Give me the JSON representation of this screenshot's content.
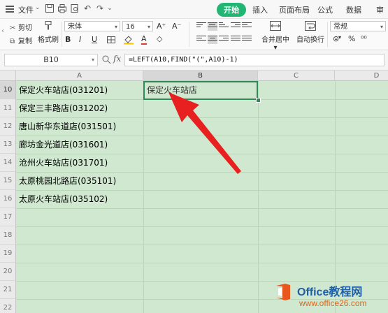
{
  "menubar": {
    "file_label": "文件",
    "tabs": [
      "开始",
      "插入",
      "页面布局",
      "公式",
      "数据",
      "审"
    ],
    "active_tab": "开始"
  },
  "ribbon": {
    "cut_label": "剪切",
    "copy_label": "复制",
    "format_painter_label": "格式刷",
    "font_name": "宋体",
    "font_size": "16",
    "merge_label": "合并居中",
    "wrap_label": "自动换行",
    "number_format": "常规",
    "bold": "B",
    "italic": "I",
    "underline": "U",
    "font_color_glyph": "A",
    "percent": "%"
  },
  "formula_bar": {
    "name_box": "B10",
    "fx_label": "fx",
    "formula": "=LEFT(A10,FIND(\"(\",A10)-1)"
  },
  "grid": {
    "columns": [
      "A",
      "B",
      "C",
      "D"
    ],
    "selected_column": "B",
    "rows": [
      "10",
      "11",
      "12",
      "13",
      "14",
      "15",
      "16",
      "17",
      "18",
      "19",
      "20",
      "21",
      "22"
    ],
    "selected_row": "10",
    "col_a_values": [
      "保定火车站店(031201)",
      "保定三丰路店(031202)",
      "唐山新华东道店(031501)",
      "廊坊金光道店(031601)",
      "沧州火车站店(031701)",
      "太原桃园北路店(035101)",
      "太原火车站店(035102)"
    ],
    "b10_value": "保定火车站店"
  },
  "watermark": {
    "name": "Office教程网",
    "url": "www.office26.com"
  },
  "colors": {
    "accent_green": "#22b573",
    "grid_bg": "#cfe8cf",
    "arrow_red": "#e8201f"
  }
}
